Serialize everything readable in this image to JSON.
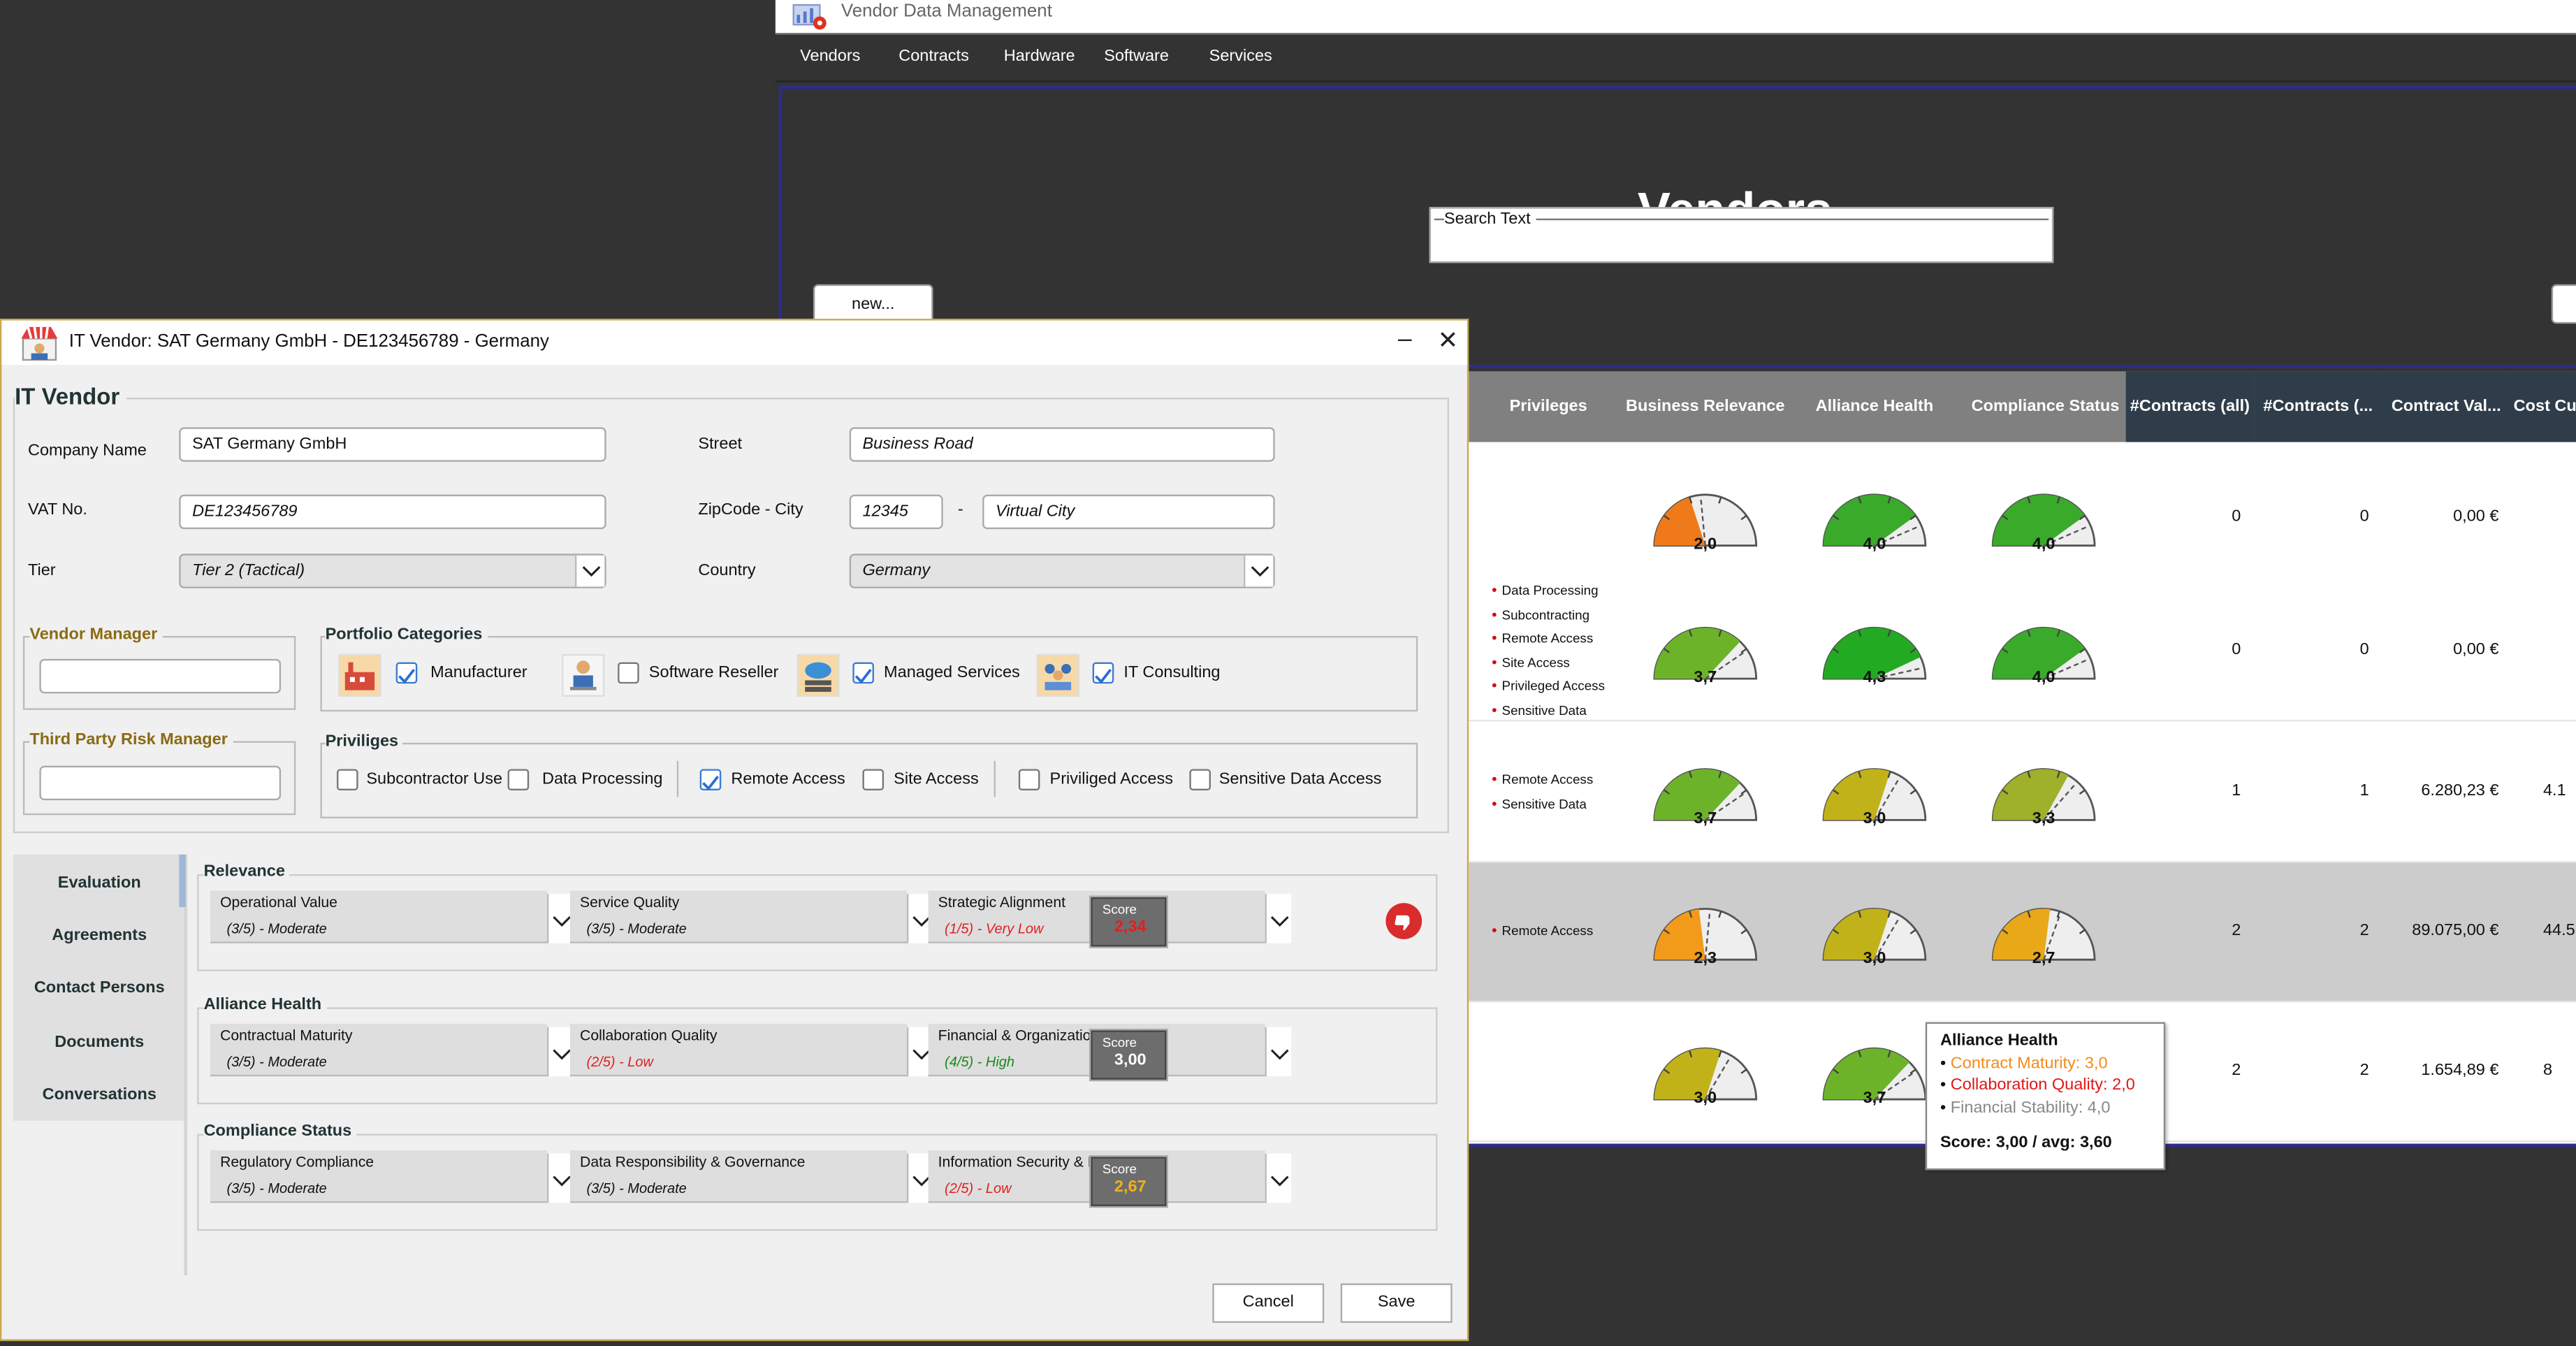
{
  "app": {
    "title": "Vendor Data Management",
    "menu": [
      "Vendors",
      "Contracts",
      "Hardware",
      "Software",
      "Services"
    ],
    "page_title": "Vendors",
    "search_label": "Search Text",
    "new_button": "new..."
  },
  "table": {
    "columns": [
      "Privileges",
      "Business Relevance",
      "Alliance Health",
      "Compliance Status",
      "#Contracts (all)",
      "#Contracts (...",
      "Contract Val...",
      "Cost Cu"
    ],
    "rows": [
      {
        "privileges": [],
        "business_relevance": "2,0",
        "alliance_health": "4,0",
        "compliance_status": "4,0",
        "contracts_all": "0",
        "contracts_active": "0",
        "contract_value": "0,00 €",
        "cost": "",
        "br_val": 2.0,
        "ah_val": 4.0,
        "cs_val": 4.0,
        "br_color": "#f07a1a",
        "ah_color": "#3aaa2a",
        "cs_color": "#3aaa2a"
      },
      {
        "privileges": [
          "Data Processing",
          "Subcontracting",
          "Remote Access",
          "Site Access",
          "Privileged Access",
          "Sensitive Data"
        ],
        "business_relevance": "3,7",
        "alliance_health": "4,3",
        "compliance_status": "4,0",
        "contracts_all": "0",
        "contracts_active": "0",
        "contract_value": "0,00 €",
        "cost": "",
        "br_val": 3.7,
        "ah_val": 4.3,
        "cs_val": 4.0,
        "br_color": "#6db32a",
        "ah_color": "#22aa22",
        "cs_color": "#3aaa2a"
      },
      {
        "privileges": [
          "Remote Access",
          "Sensitive Data"
        ],
        "business_relevance": "3,7",
        "alliance_health": "3,0",
        "compliance_status": "3,3",
        "contracts_all": "1",
        "contracts_active": "1",
        "contract_value": "6.280,23 €",
        "cost": "4.1",
        "br_val": 3.7,
        "ah_val": 3.0,
        "cs_val": 3.3,
        "br_color": "#6db32a",
        "ah_color": "#c2b21a",
        "cs_color": "#9fb02a"
      },
      {
        "privileges": [
          "Remote Access"
        ],
        "business_relevance": "2,3",
        "alliance_health": "3,0",
        "compliance_status": "2,7",
        "contracts_all": "2",
        "contracts_active": "2",
        "contract_value": "89.075,00 €",
        "cost": "44.5",
        "br_val": 2.3,
        "ah_val": 3.0,
        "cs_val": 2.7,
        "br_color": "#f29a1a",
        "ah_color": "#c2b21a",
        "cs_color": "#e8a818"
      },
      {
        "privileges": [],
        "business_relevance": "3,0",
        "alliance_health": "3,7",
        "compliance_status": "",
        "contracts_all": "2",
        "contracts_active": "2",
        "contract_value": "1.654,89 €",
        "cost": "8",
        "br_val": 3.0,
        "ah_val": 3.7,
        "cs_val": null,
        "br_color": "#c2b21a",
        "ah_color": "#6db32a",
        "cs_color": ""
      }
    ]
  },
  "tooltip": {
    "title": "Alliance Health",
    "items": [
      {
        "text": "Contract Maturity: 3,0",
        "color": "#f28c1a"
      },
      {
        "text": "Collaboration Quality: 2,0",
        "color": "#e01818"
      },
      {
        "text": "Financial Stability: 4,0",
        "color": "#888888"
      }
    ],
    "score": "Score: 3,00 / avg: 3,60"
  },
  "dialog": {
    "title": "IT Vendor: SAT Germany GmbH  - DE123456789  - Germany",
    "heading": "IT Vendor",
    "fields": {
      "company_name_label": "Company Name",
      "company_name": "SAT Germany GmbH",
      "vat_label": "VAT No.",
      "vat": "DE123456789",
      "tier_label": "Tier",
      "tier": "Tier 2 (Tactical)",
      "street_label": "Street",
      "street": "Business Road",
      "zip_label": "ZipCode - City",
      "zip": "12345",
      "zip_sep": "-",
      "city": "Virtual City",
      "country_label": "Country",
      "country": "Germany"
    },
    "vendor_manager_label": "Vendor Manager",
    "third_party_label": "Third Party Risk Manager",
    "portfolio": {
      "title": "Portfolio Categories",
      "items": [
        {
          "label": "Manufacturer",
          "checked": true
        },
        {
          "label": "Software Reseller",
          "checked": false
        },
        {
          "label": "Managed Services",
          "checked": true
        },
        {
          "label": "IT Consulting",
          "checked": true
        }
      ]
    },
    "privileges": {
      "title": "Priviliges",
      "items": [
        {
          "label": "Subcontractor Use",
          "checked": false
        },
        {
          "label": "Data Processing",
          "checked": false
        },
        {
          "label": "Remote Access",
          "checked": true
        },
        {
          "label": "Site Access",
          "checked": false
        },
        {
          "label": "Priviliged Access",
          "checked": false
        },
        {
          "label": "Sensitive Data Access",
          "checked": false
        }
      ]
    },
    "tabs": [
      "Evaluation",
      "Agreements",
      "Contact Persons",
      "Documents",
      "Conversations"
    ],
    "evaluation": [
      {
        "title": "Relevance",
        "score_label": "Score",
        "score": "2,34",
        "score_color": "#e02020",
        "items": [
          {
            "label": "Operational Value",
            "value": "(3/5) - Moderate",
            "color": "#111111"
          },
          {
            "label": "Service Quality",
            "value": "(3/5) - Moderate",
            "color": "#111111"
          },
          {
            "label": "Strategic Alignment",
            "value": "(1/5) - Very Low",
            "color": "#e02020"
          }
        ]
      },
      {
        "title": "Alliance Health",
        "score_label": "Score",
        "score": "3,00",
        "score_color": "#ffffff",
        "items": [
          {
            "label": "Contractual Maturity",
            "value": "(3/5) - Moderate",
            "color": "#111111"
          },
          {
            "label": "Collaboration Quality",
            "value": "(2/5) - Low",
            "color": "#e02020"
          },
          {
            "label": "Financial & Organizational Stability",
            "value": "(4/5) - High",
            "color": "#1a8a1a"
          }
        ]
      },
      {
        "title": "Compliance Status",
        "score_label": "Score",
        "score": "2,67",
        "score_color": "#f0b020",
        "items": [
          {
            "label": "Regulatory Compliance",
            "value": "(3/5) - Moderate",
            "color": "#111111"
          },
          {
            "label": "Data Responsibility & Governance",
            "value": "(3/5) - Moderate",
            "color": "#111111"
          },
          {
            "label": "Information Security & Resilience",
            "value": "(2/5) - Low",
            "color": "#e02020"
          }
        ]
      }
    ],
    "cancel": "Cancel",
    "save": "Save"
  }
}
